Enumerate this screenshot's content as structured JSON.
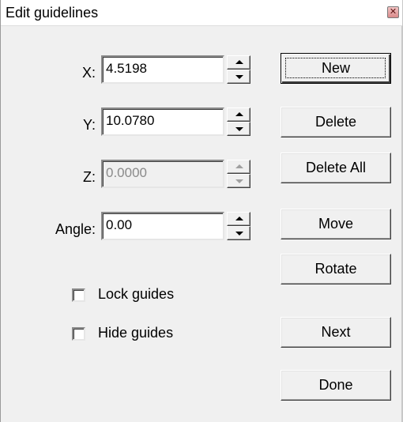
{
  "window": {
    "title": "Edit guidelines"
  },
  "fields": {
    "x": {
      "label": "X:",
      "value": "4.5198"
    },
    "y": {
      "label": "Y:",
      "value": "10.0780"
    },
    "z": {
      "label": "Z:",
      "value": "0.0000",
      "disabled": true
    },
    "angle": {
      "label": "Angle:",
      "value": "0.00"
    }
  },
  "buttons": {
    "new": "New",
    "delete": "Delete",
    "delete_all": "Delete All",
    "move": "Move",
    "rotate": "Rotate",
    "next": "Next",
    "done": "Done"
  },
  "checkboxes": {
    "lock_guides": {
      "label": "Lock guides",
      "checked": false
    },
    "hide_guides": {
      "label": "Hide guides",
      "checked": false
    }
  },
  "icons": {
    "close": "close-icon"
  }
}
